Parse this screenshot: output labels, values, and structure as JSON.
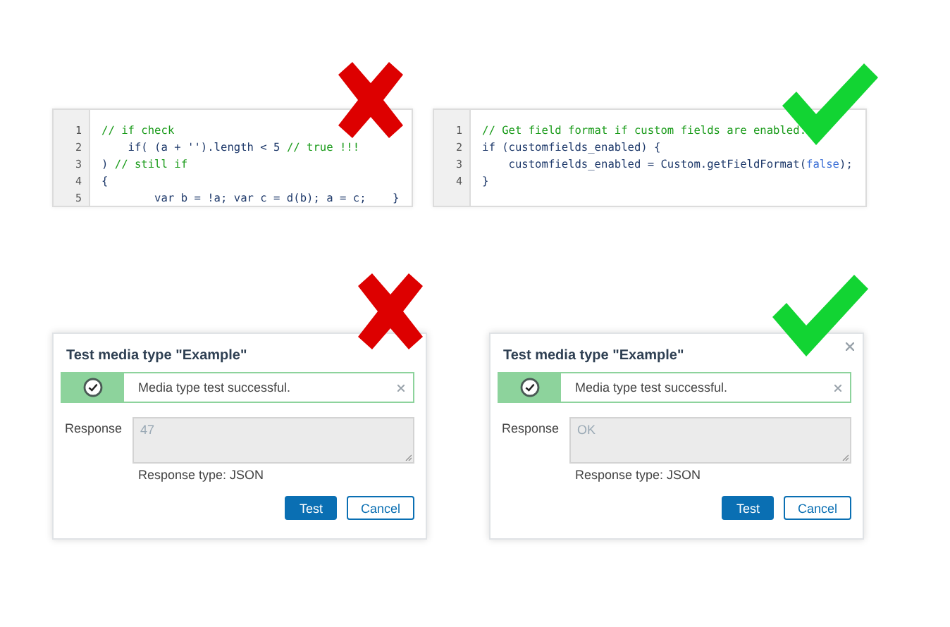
{
  "code_examples": [
    {
      "kind": "bad",
      "lines": [
        {
          "number": "1",
          "segments": [
            {
              "kind": "comment",
              "text": "// if check"
            }
          ]
        },
        {
          "number": "2",
          "segments": [
            {
              "kind": "code",
              "text": "    if( (a + '').length < 5 "
            },
            {
              "kind": "comment",
              "text": "// true !!!"
            }
          ]
        },
        {
          "number": "3",
          "segments": [
            {
              "kind": "code",
              "text": ") "
            },
            {
              "kind": "comment",
              "text": "// still if"
            }
          ]
        },
        {
          "number": "4",
          "segments": [
            {
              "kind": "code",
              "text": "{"
            }
          ]
        },
        {
          "number": "5",
          "segments": [
            {
              "kind": "code",
              "text": "        var b = !a; var c = d(b); a = c;    }"
            }
          ]
        }
      ]
    },
    {
      "kind": "good",
      "lines": [
        {
          "number": "1",
          "segments": [
            {
              "kind": "comment",
              "text": "// Get field format if custom fields are enabled."
            }
          ]
        },
        {
          "number": "2",
          "segments": [
            {
              "kind": "code",
              "text": "if (customfields_enabled) {"
            }
          ]
        },
        {
          "number": "3",
          "segments": [
            {
              "kind": "code",
              "text": "    customfields_enabled = Custom.getFieldFormat("
            },
            {
              "kind": "keyword",
              "text": "false"
            },
            {
              "kind": "code",
              "text": ");"
            }
          ]
        },
        {
          "number": "4",
          "segments": [
            {
              "kind": "code",
              "text": "}"
            }
          ]
        }
      ]
    }
  ],
  "dialogs": [
    {
      "kind": "bad",
      "closable": false,
      "title": "Test media type \"Example\"",
      "message": "Media type test successful.",
      "response_label": "Response",
      "response_value": "47",
      "response_type": "Response type: JSON",
      "buttons": [
        {
          "label": "Test",
          "kind": "primary"
        },
        {
          "label": "Cancel",
          "kind": "secondary"
        }
      ]
    },
    {
      "kind": "good",
      "closable": true,
      "title": "Test media type \"Example\"",
      "message": "Media type test successful.",
      "response_label": "Response",
      "response_value": "OK",
      "response_type": "Response type: JSON",
      "buttons": [
        {
          "label": "Test",
          "kind": "primary"
        },
        {
          "label": "Cancel",
          "kind": "secondary"
        }
      ]
    }
  ]
}
